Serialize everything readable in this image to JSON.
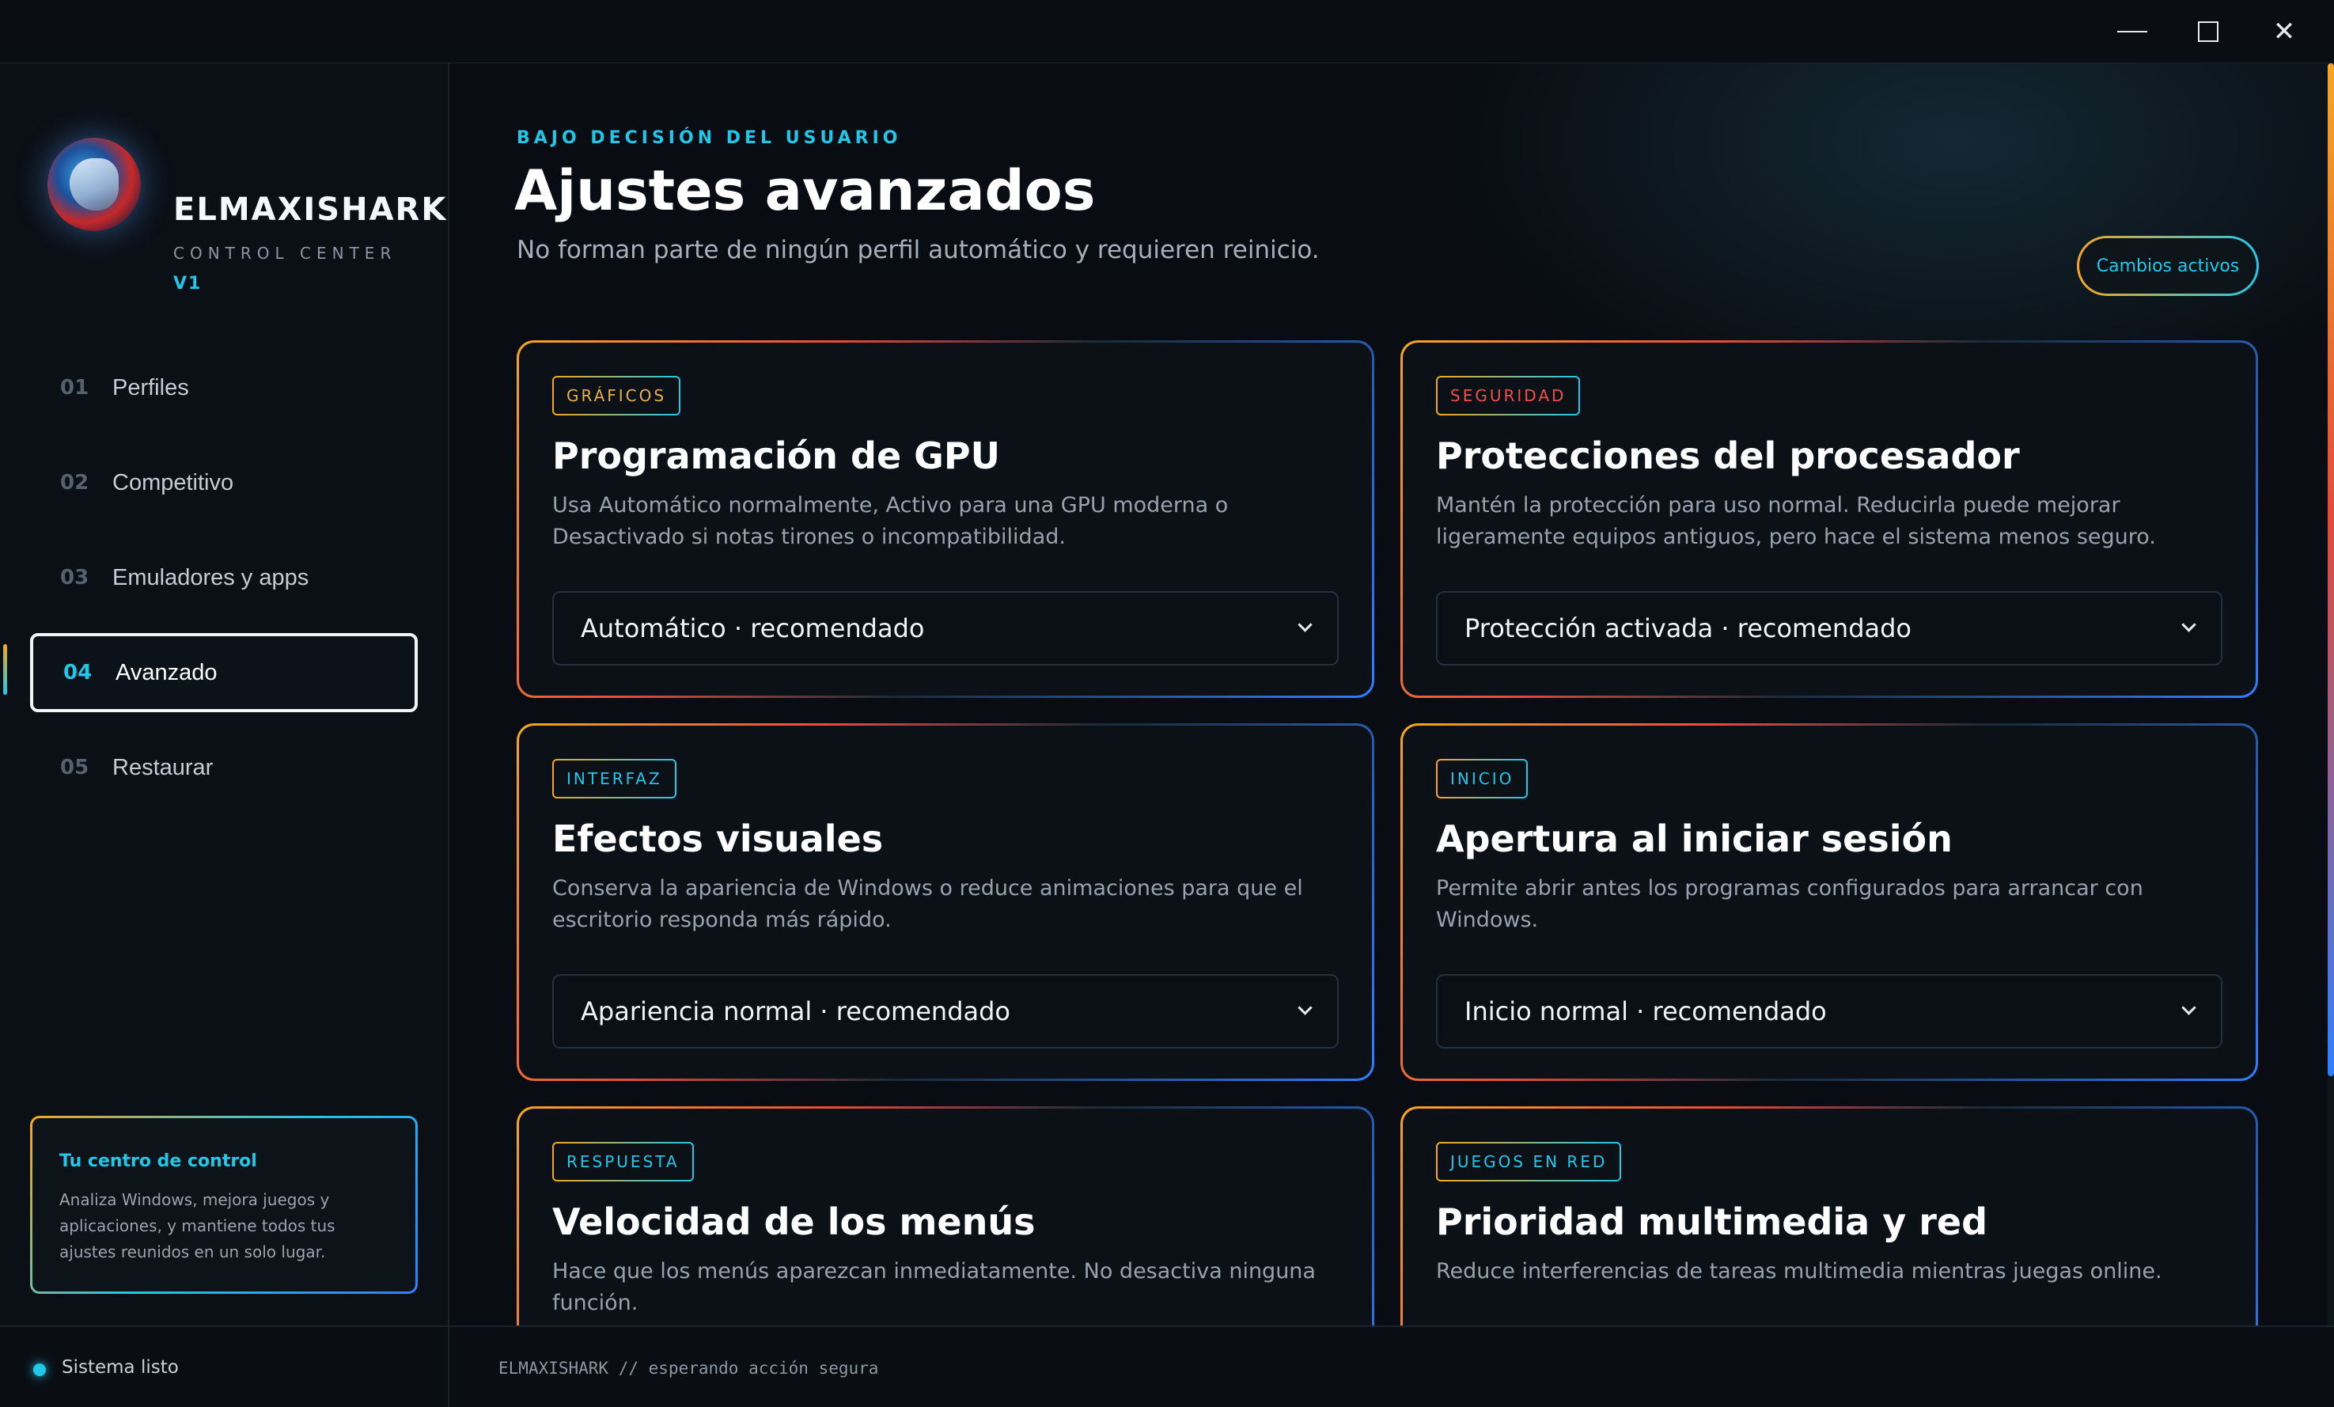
{
  "window": {
    "controls": {
      "minimize": "minimize-icon",
      "maximize": "maximize-icon",
      "close": "close-icon",
      "close_glyph": "✕"
    }
  },
  "brand": {
    "name": "ELMAXISHARK",
    "subtitle": "CONTROL CENTER",
    "version": "V1"
  },
  "sidebar": {
    "items": [
      {
        "num": "01",
        "label": "Perfiles",
        "active": false
      },
      {
        "num": "02",
        "label": "Competitivo",
        "active": false
      },
      {
        "num": "03",
        "label": "Emuladores y apps",
        "active": false
      },
      {
        "num": "04",
        "label": "Avanzado",
        "active": true
      },
      {
        "num": "05",
        "label": "Restaurar",
        "active": false
      }
    ],
    "info_card": {
      "title": "Tu centro de control",
      "text": "Analiza Windows, mejora juegos y aplicaciones, y mantiene todos tus ajustes reunidos en un solo lugar."
    }
  },
  "header": {
    "eyebrow": "BAJO DECISIÓN DEL USUARIO",
    "title": "Ajustes avanzados",
    "subtitle": "No forman parte de ningún perfil automático y requieren reinicio.",
    "status_pill": "Cambios activos"
  },
  "cards": [
    {
      "tag": "GRÁFICOS",
      "tag_color": "#e8b04a",
      "title": "Programación de GPU",
      "desc": "Usa Automático normalmente, Activo para una GPU moderna o Desactivado si notas tirones o incompatibilidad.",
      "select_value": "Automático · recomendado"
    },
    {
      "tag": "SEGURIDAD",
      "tag_color": "#f0504a",
      "title": "Protecciones del procesador",
      "desc": "Mantén la protección para uso normal. Reducirla puede mejorar ligeramente equipos antiguos, pero hace el sistema menos seguro.",
      "select_value": "Protección activada · recomendado"
    },
    {
      "tag": "INTERFAZ",
      "tag_color": "#22c7e8",
      "title": "Efectos visuales",
      "desc": "Conserva la apariencia de Windows o reduce animaciones para que el escritorio responda más rápido.",
      "select_value": "Apariencia normal · recomendado"
    },
    {
      "tag": "INICIO",
      "tag_color": "#22c7e8",
      "title": "Apertura al iniciar sesión",
      "desc": "Permite abrir antes los programas configurados para arrancar con Windows.",
      "select_value": "Inicio normal · recomendado"
    },
    {
      "tag": "RESPUESTA",
      "tag_color": "#22c7e8",
      "title": "Velocidad de los menús",
      "desc": "Hace que los menús aparezcan inmediatamente. No desactiva ninguna función.",
      "select_value": ""
    },
    {
      "tag": "JUEGOS EN RED",
      "tag_color": "#22c7e8",
      "title": "Prioridad multimedia y red",
      "desc": "Reduce interferencias de tareas multimedia mientras juegas online.",
      "select_value": ""
    }
  ],
  "statusbar": {
    "status": "Sistema listo",
    "log": "ELMAXISHARK // esperando acción segura"
  },
  "colors": {
    "accent_cyan": "#22c7e8",
    "accent_orange": "#f5a623",
    "accent_red": "#e84a3c",
    "accent_blue": "#2f7fff",
    "background": "#090d13"
  }
}
